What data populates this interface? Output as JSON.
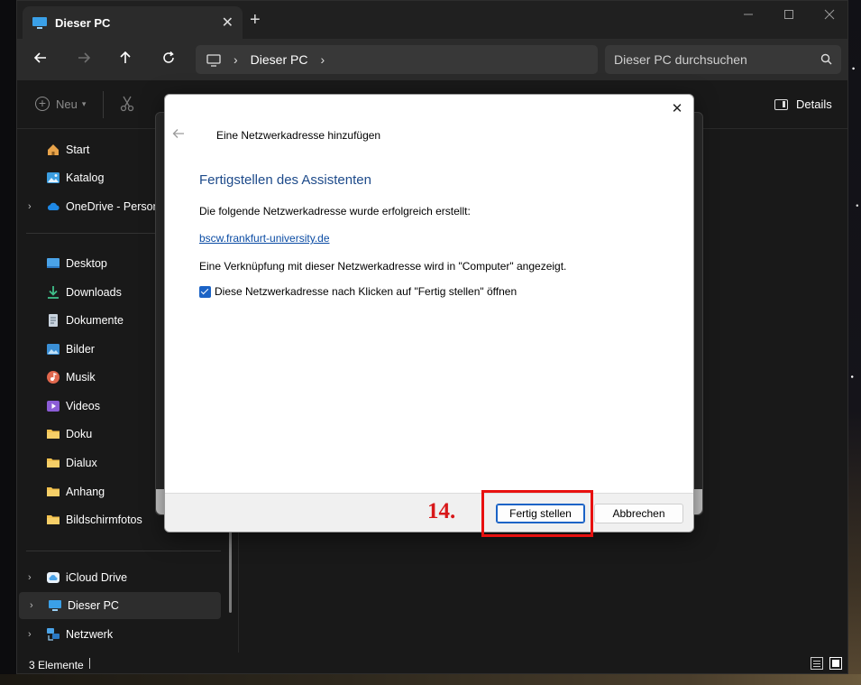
{
  "window": {
    "tab_title": "Dieser PC",
    "new_tab_glyph": "+",
    "tab_close_glyph": "✕"
  },
  "nav": {
    "address_segment": "Dieser PC",
    "search_placeholder": "Dieser PC durchsuchen"
  },
  "commandbar": {
    "new_label": "Neu",
    "details_label": "Details"
  },
  "sidebar": {
    "items": [
      {
        "label": "Start",
        "icon": "home-icon",
        "color": "#e8a34a",
        "expandable": false
      },
      {
        "label": "Katalog",
        "icon": "gallery-icon",
        "color": "#3b9de0",
        "expandable": false
      },
      {
        "label": "OneDrive - Persona",
        "icon": "cloud-icon",
        "color": "#1e88e5",
        "expandable": true
      },
      {
        "label": "Desktop",
        "icon": "desktop-icon",
        "color": "#4aa3e8",
        "expandable": false
      },
      {
        "label": "Downloads",
        "icon": "download-icon",
        "color": "#3fbf8a",
        "expandable": false
      },
      {
        "label": "Dokumente",
        "icon": "document-icon",
        "color": "#c9d3de",
        "expandable": false
      },
      {
        "label": "Bilder",
        "icon": "pictures-icon",
        "color": "#3a8fd6",
        "expandable": false
      },
      {
        "label": "Musik",
        "icon": "music-icon",
        "color": "#e0674d",
        "expandable": false
      },
      {
        "label": "Videos",
        "icon": "video-icon",
        "color": "#8b5cd6",
        "expandable": false
      },
      {
        "label": "Doku",
        "icon": "folder-icon",
        "color": "#f2c14e",
        "expandable": false
      },
      {
        "label": "Dialux",
        "icon": "folder-icon",
        "color": "#f2c14e",
        "expandable": false
      },
      {
        "label": "Anhang",
        "icon": "folder-icon",
        "color": "#f2c14e",
        "expandable": false
      },
      {
        "label": "Bildschirmfotos",
        "icon": "folder-icon",
        "color": "#f2c14e",
        "expandable": false
      },
      {
        "label": "iCloud Drive",
        "icon": "icloud-icon",
        "color": "#4aa3e8",
        "expandable": true
      },
      {
        "label": "Dieser PC",
        "icon": "pc-icon",
        "color": "#4aa3e8",
        "expandable": true,
        "selected": true
      },
      {
        "label": "Netzwerk",
        "icon": "network-icon",
        "color": "#4aa3e8",
        "expandable": true
      }
    ]
  },
  "status": {
    "item_count": "3 Elemente"
  },
  "dialog": {
    "heading": "Eine Netzwerkadresse hinzufügen",
    "title": "Fertigstellen des Assistenten",
    "line1": "Die folgende Netzwerkadresse wurde erfolgreich erstellt:",
    "link": "bscw.frankfurt-university.de",
    "line2": "Eine Verknüpfung mit dieser Netzwerkadresse wird in \"Computer\" angezeigt.",
    "checkbox_label": "Diese Netzwerkadresse nach Klicken auf \"Fertig stellen\" öffnen",
    "checkbox_checked": true,
    "finish_label": "Fertig stellen",
    "cancel_label": "Abbrechen",
    "close_glyph": "✕"
  },
  "annotation": {
    "step_label": "14.",
    "color": "#e8100f"
  }
}
